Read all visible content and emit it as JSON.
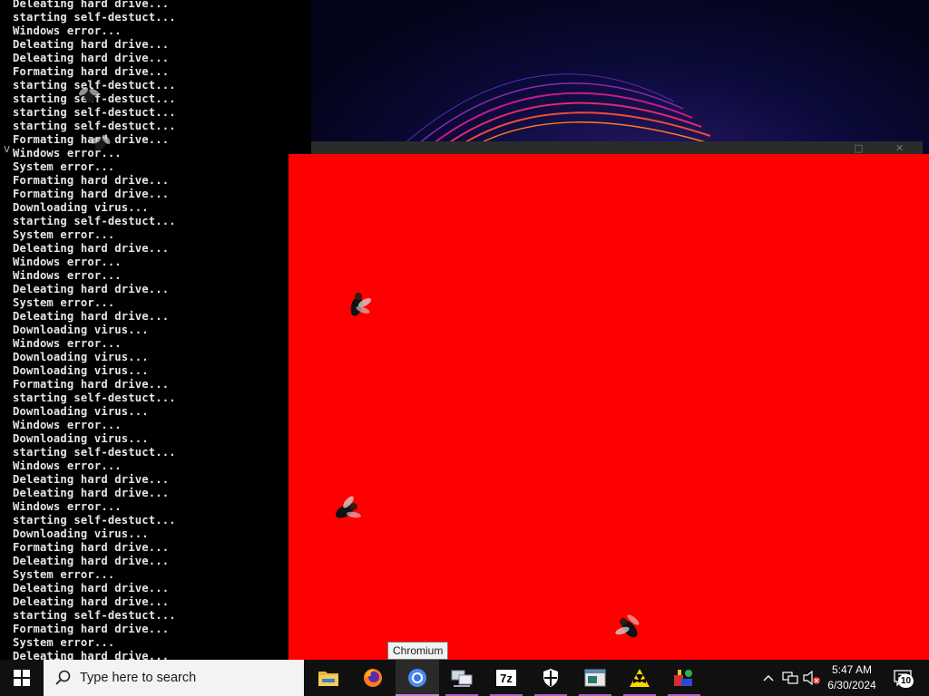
{
  "console": {
    "lines": [
      "Deleating hard drive...",
      "starting self-destuct...",
      "Windows error...",
      "Deleating hard drive...",
      "Deleating hard drive...",
      "Formating hard drive...",
      "starting self-destuct...",
      "starting self-destuct...",
      "starting self-destuct...",
      "starting self-destuct...",
      "Formating hard drive...",
      "Windows error...",
      "System error...",
      "Formating hard drive...",
      "Formating hard drive...",
      "Downloading virus...",
      "starting self-destuct...",
      "System error...",
      "Deleating hard drive...",
      "Windows error...",
      "Windows error...",
      "Deleating hard drive...",
      "System error...",
      "Deleating hard drive...",
      "Downloading virus...",
      "Windows error...",
      "Downloading virus...",
      "Downloading virus...",
      "Formating hard drive...",
      "starting self-destuct...",
      "Downloading virus...",
      "Windows error...",
      "Downloading virus...",
      "starting self-destuct...",
      "Windows error...",
      "Deleating hard drive...",
      "Deleating hard drive...",
      "Windows error...",
      "starting self-destuct...",
      "Downloading virus...",
      "Formating hard drive...",
      "Deleating hard drive...",
      "System error...",
      "Deleating hard drive...",
      "Deleating hard drive...",
      "starting self-destuct...",
      "Formating hard drive...",
      "System error...",
      "Deleating hard drive..."
    ]
  },
  "red_window": {
    "color": "#ff0000"
  },
  "taskbar": {
    "search_placeholder": "Type here to search",
    "tooltip": "Chromium",
    "apps": [
      {
        "name": "file-explorer",
        "icon": "folder-icon"
      },
      {
        "name": "firefox",
        "icon": "firefox-icon"
      },
      {
        "name": "chromium",
        "icon": "chromium-icon",
        "active": true
      },
      {
        "name": "network-app",
        "icon": "network-app-icon"
      },
      {
        "name": "7zip",
        "icon": "7zip-icon",
        "label": "7z"
      },
      {
        "name": "security",
        "icon": "shield-icon"
      },
      {
        "name": "window-app",
        "icon": "window-app-icon"
      },
      {
        "name": "radiation-app",
        "icon": "radiation-icon"
      },
      {
        "name": "paint-app",
        "icon": "paint-icon"
      }
    ],
    "clock": {
      "time": "5:47 AM",
      "date": "6/30/2024"
    },
    "notification_count": "10"
  }
}
